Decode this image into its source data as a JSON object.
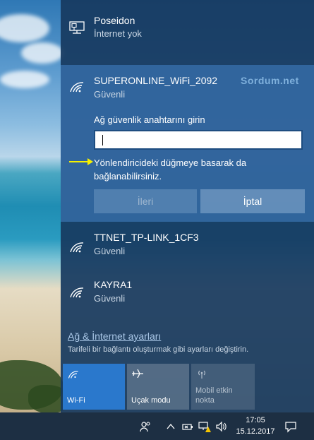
{
  "networks": {
    "poseidon": {
      "name": "Poseidon",
      "status": "İnternet yok",
      "icon": "ethernet-icon"
    },
    "selected": {
      "name": "SUPERONLINE_WiFi_2092",
      "status": "Güvenli",
      "icon": "wifi-icon",
      "key_label": "Ağ güvenlik anahtarını girin",
      "key_value": "",
      "hint": "Yönlendiricideki düğmeye basarak da bağlanabilirsiniz.",
      "next_label": "İleri",
      "cancel_label": "İptal"
    },
    "ttnet": {
      "name": "TTNET_TP-LINK_1CF3",
      "status": "Güvenli",
      "icon": "wifi-icon"
    },
    "kayra": {
      "name": "KAYRA1",
      "status": "Güvenli",
      "icon": "wifi-icon"
    }
  },
  "watermark": "Sordum.net",
  "settings": {
    "link": "Ağ & İnternet ayarları",
    "description": "Tarifeli bir bağlantı oluşturmak gibi ayarları değiştirin."
  },
  "quick_actions": [
    {
      "label": "Wi-Fi",
      "icon": "wifi-icon",
      "active": true
    },
    {
      "label": "Uçak modu",
      "icon": "airplane-icon",
      "active": false
    },
    {
      "label": "Mobil etkin nokta",
      "icon": "mobile-hotspot-icon",
      "active": false
    }
  ],
  "taskbar": {
    "time": "17:05",
    "date": "15.12.2017",
    "icons": [
      "people-icon",
      "chevron-up-icon",
      "battery-icon",
      "network-warning-icon",
      "volume-icon",
      "action-center-icon"
    ]
  },
  "colors": {
    "accent": "#2a78cc",
    "flyout": "#173a60",
    "arrow": "#f5f000"
  }
}
